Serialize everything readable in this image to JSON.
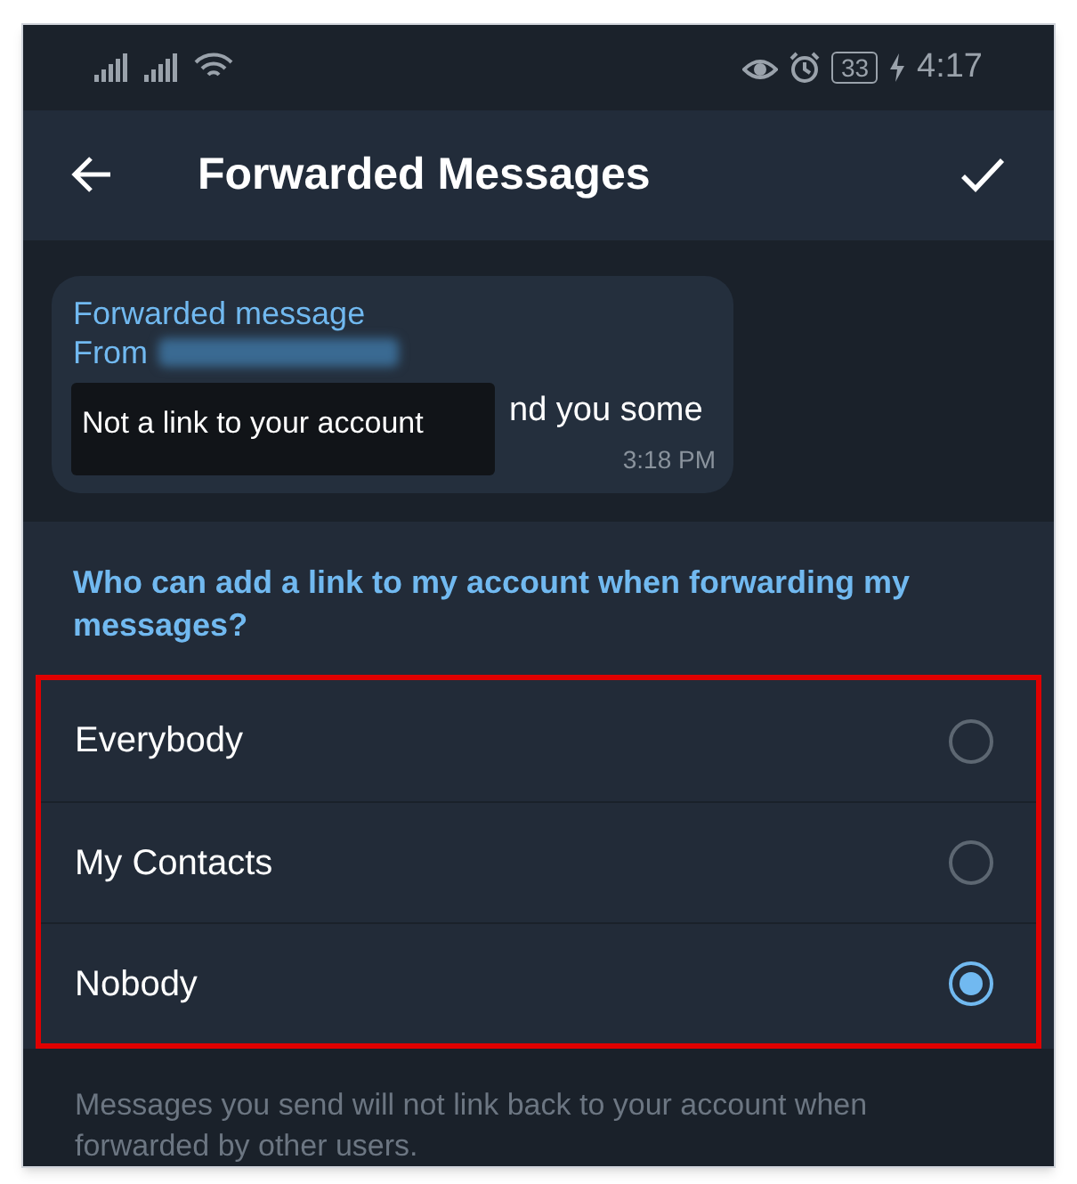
{
  "status_bar": {
    "time": "4:17",
    "battery": "33"
  },
  "header": {
    "title": "Forwarded Messages"
  },
  "message": {
    "label": "Forwarded message",
    "from": "From",
    "text": "nd you some",
    "time": "3:18 PM",
    "tooltip": "Not a link to your account"
  },
  "section": {
    "title": "Who can add a link to my account when forwarding my messages?"
  },
  "options": [
    {
      "label": "Everybody",
      "selected": false
    },
    {
      "label": "My Contacts",
      "selected": false
    },
    {
      "label": "Nobody",
      "selected": true
    }
  ],
  "footer": "Messages you send will not link back to your account when forwarded by other users."
}
